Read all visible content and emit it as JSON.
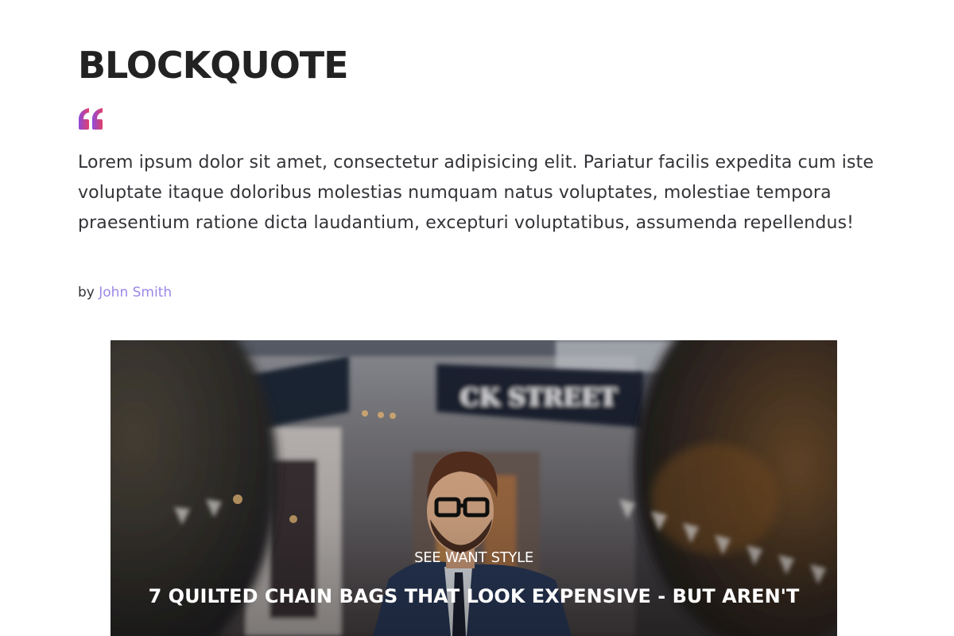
{
  "blockquote_section": {
    "heading": "BLOCKQUOTE",
    "quote_icon": "quote-icon",
    "quote_text": "Lorem ipsum dolor sit amet, consectetur adipisicing elit. Pariatur facilis expedita cum iste voluptate itaque doloribus molestias numquam natus voluptates, molestiae tempora praesentium ratione dicta laudantium, excepturi voluptatibus, assumenda repellendus!",
    "by_label": "by",
    "author": "John Smith"
  },
  "hero_card": {
    "category": "SEE WANT STYLE",
    "title": "7 QUILTED CHAIN BAGS THAT LOOK EXPENSIVE - BUT AREN'T",
    "sign_text": "CK STREET"
  },
  "colors": {
    "accent_link": "#9b87e8",
    "quote_gradient_start": "#8e4bd9",
    "quote_gradient_end": "#e0406a",
    "heading": "#222222",
    "body_text": "#333338"
  }
}
